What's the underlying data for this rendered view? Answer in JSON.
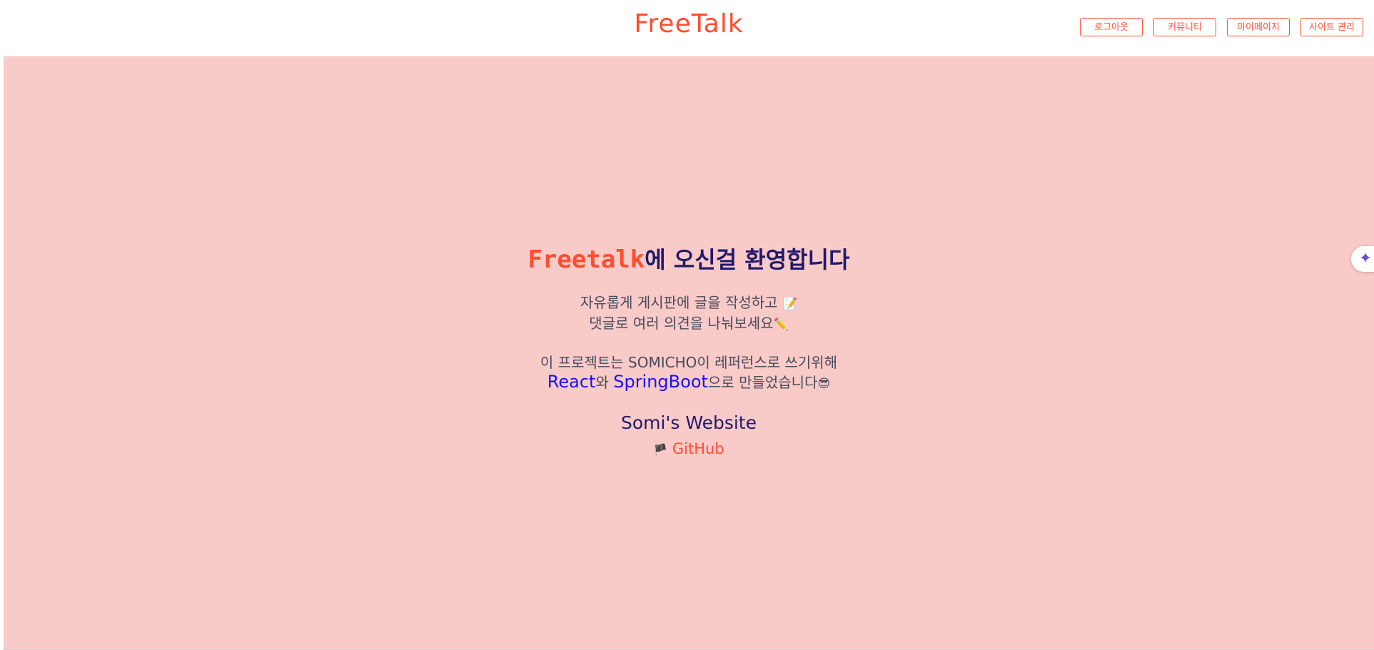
{
  "header": {
    "logo": "FreeTalk",
    "nav": [
      {
        "label": "로그아웃"
      },
      {
        "label": "커뮤니티"
      },
      {
        "label": "마이페이지"
      },
      {
        "label": "사이트 관리"
      }
    ]
  },
  "hero": {
    "title_brand": "Freetalk",
    "title_rest": "에 오신걸 환영합니다",
    "desc_line1": "자유롭게 게시판에 글을 작성하고",
    "desc_line1_emoji": "📝",
    "desc_line2": "댓글로 여러 의견을 나눠보세요",
    "desc_line2_emoji": "✏️",
    "project_line1": "이 프로젝트는 SOMICHO이 레퍼런스로 쓰기위해",
    "tech_react": "React",
    "tech_joiner": "와 ",
    "tech_spring": "SpringBoot",
    "project_line2_rest": "으로 만들었습니다",
    "project_emoji": "😎",
    "site_link": "Somi's Website",
    "github_flag": "🏴",
    "github_link": "GitHub"
  },
  "side_button": {
    "icon": "sparkle-icon",
    "glyph": "✦"
  },
  "colors": {
    "accent": "#ff4d2e",
    "hero_bg": "#f8cac8",
    "title": "#22196b",
    "tech": "#1a12f0"
  }
}
